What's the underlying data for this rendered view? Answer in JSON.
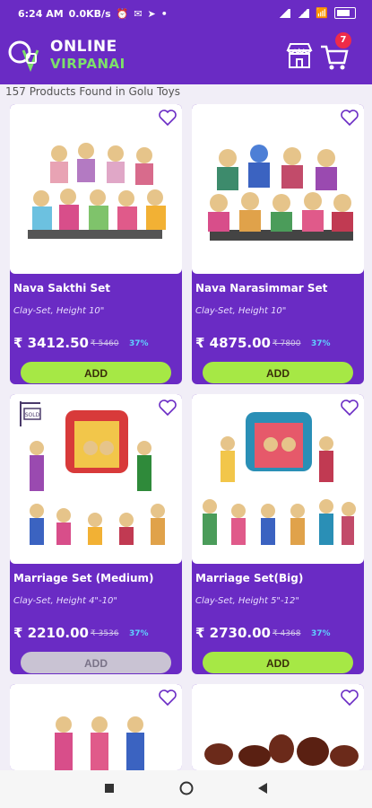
{
  "status": {
    "time": "6:24 AM",
    "speed": "0.0KB/s",
    "battery": "85"
  },
  "brand": {
    "line1": "ONLINE",
    "line2": "VIRPANAI"
  },
  "cart": {
    "count": "7"
  },
  "results": {
    "text": "157 Products Found in Golu Toys"
  },
  "products": [
    {
      "name": "Nava Sakthi Set",
      "spec": "Clay-Set, Height 10\"",
      "price": "₹ 3412.50",
      "mrp": "₹ 5460",
      "off": "37%",
      "add_label": "ADD",
      "add_enabled": true
    },
    {
      "name": "Nava Narasimmar Set",
      "spec": "Clay-Set, Height 10\"",
      "price": "₹ 4875.00",
      "mrp": "₹ 7800",
      "off": "37%",
      "add_label": "ADD",
      "add_enabled": true
    },
    {
      "name": "Marriage Set (Medium)",
      "spec": "Clay-Set, Height 4\"-10\"",
      "price": "₹ 2210.00",
      "mrp": "₹ 3536",
      "off": "37%",
      "add_label": "ADD",
      "add_enabled": false,
      "sold_badge": "SOLD"
    },
    {
      "name": "Marriage Set(Big)",
      "spec": "Clay-Set, Height 5\"-12\"",
      "price": "₹ 2730.00",
      "mrp": "₹ 4368",
      "off": "37%",
      "add_label": "ADD",
      "add_enabled": true
    }
  ],
  "colors": {
    "brand": "#6a2bc4",
    "add": "#a6e845",
    "discount": "#5fd0ff",
    "badge": "#ef2b49"
  }
}
